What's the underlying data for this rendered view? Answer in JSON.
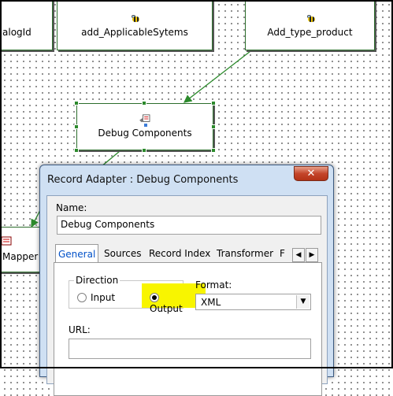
{
  "canvas": {
    "nodes": [
      {
        "label": "alogId"
      },
      {
        "label": "add_ApplicableSytems"
      },
      {
        "label": "Add_type_product"
      },
      {
        "label": "Debug Components"
      },
      {
        "label": "Mapper"
      }
    ],
    "node_icon": "bee-icon",
    "selected_icon": "debug-icon",
    "connector_color": "#2c8a2c"
  },
  "dialog": {
    "title": "Record Adapter :  Debug Components",
    "close_label": "✕",
    "name_label": "Name:",
    "name_value": "Debug Components",
    "tabs": [
      "General",
      "Sources",
      "Record Index",
      "Transformer",
      "F"
    ],
    "active_tab": "General",
    "tab_scroll_left": "◀",
    "tab_scroll_right": "▶",
    "direction": {
      "title": "Direction",
      "options": [
        "Input",
        "Output"
      ],
      "selected": "Output",
      "highlight_color": "#f8f500"
    },
    "format": {
      "label": "Format:",
      "value": "XML",
      "arrow": "▼"
    },
    "url": {
      "label": "URL:",
      "value": ""
    }
  }
}
